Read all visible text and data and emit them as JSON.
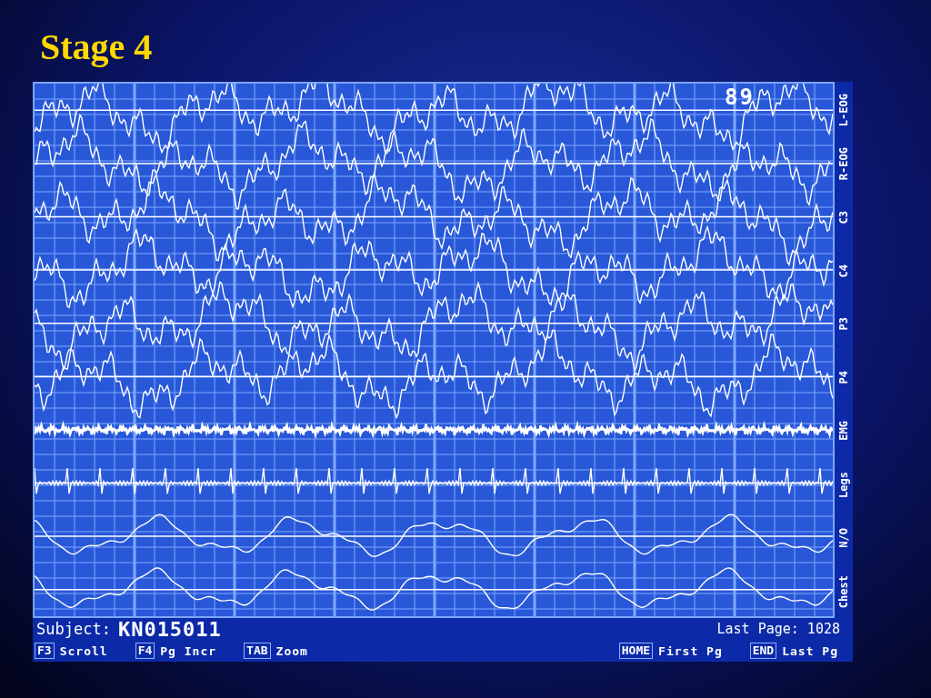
{
  "slide_title": "Stage 4",
  "page_number": "89",
  "channels": [
    {
      "label": "L-EOG",
      "kind": "eeg"
    },
    {
      "label": "R-EOG",
      "kind": "eeg"
    },
    {
      "label": "C3",
      "kind": "eeg"
    },
    {
      "label": "C4",
      "kind": "eeg"
    },
    {
      "label": "P3",
      "kind": "eeg"
    },
    {
      "label": "P4",
      "kind": "eeg"
    },
    {
      "label": "EMG",
      "kind": "emg"
    },
    {
      "label": "Legs",
      "kind": "spikes"
    },
    {
      "label": "N/O",
      "kind": "resp"
    },
    {
      "label": "Chest",
      "kind": "resp"
    }
  ],
  "subject": {
    "label": "Subject:",
    "value": "KN015011"
  },
  "last_page": "Last Page: 1028",
  "keys": [
    {
      "key": "F3",
      "action": "Scroll"
    },
    {
      "key": "F4",
      "action": "Pg Incr"
    },
    {
      "key": "TAB",
      "action": "Zoom"
    },
    {
      "key": "HOME",
      "action": "First Pg"
    },
    {
      "key": "END",
      "action": "Last Pg"
    }
  ]
}
